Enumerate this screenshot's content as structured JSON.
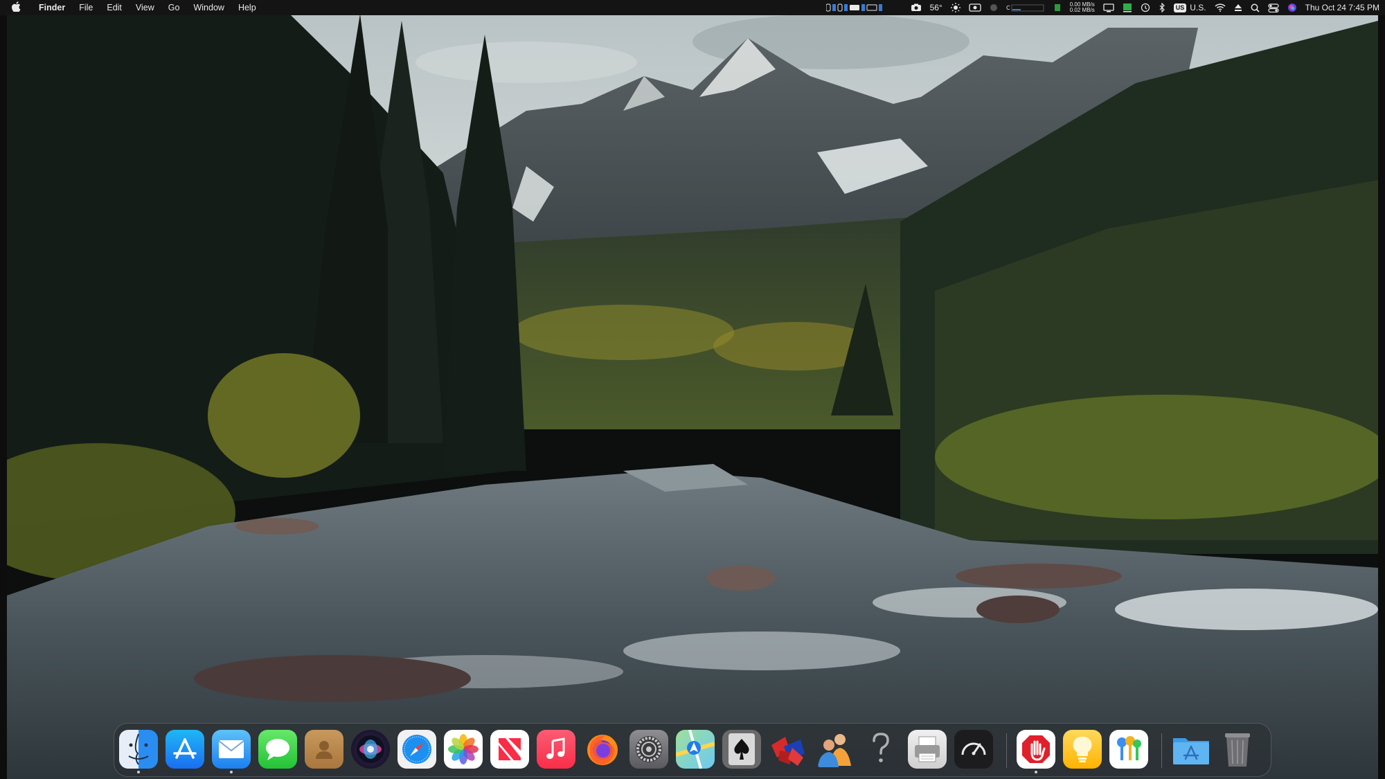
{
  "menubar": {
    "apple_icon": "apple-logo-icon",
    "app_name": "Finder",
    "menus": [
      "File",
      "Edit",
      "View",
      "Go",
      "Window",
      "Help"
    ],
    "status": {
      "temperature": "56°",
      "weather_icon": "sun-icon",
      "net_up": "0.00 MB/s",
      "net_down": "0.02 MB/s",
      "input_source_badge": "US",
      "input_source_label": "U.S.",
      "datetime": "Thu Oct 24  7:45 PM"
    }
  },
  "dock": {
    "apps": [
      {
        "name": "Finder",
        "icon": "finder-icon",
        "running": true
      },
      {
        "name": "App Store",
        "icon": "app-store-icon",
        "running": false
      },
      {
        "name": "Mail",
        "icon": "mail-icon",
        "running": true
      },
      {
        "name": "Messages",
        "icon": "messages-icon",
        "running": false
      },
      {
        "name": "Contacts",
        "icon": "contacts-icon",
        "running": false
      },
      {
        "name": "Siri",
        "icon": "siri-icon",
        "running": false
      },
      {
        "name": "Safari",
        "icon": "safari-icon",
        "running": false
      },
      {
        "name": "Photos",
        "icon": "photos-icon",
        "running": false
      },
      {
        "name": "News",
        "icon": "news-icon",
        "running": false
      },
      {
        "name": "Music",
        "icon": "music-icon",
        "running": false
      },
      {
        "name": "Firefox",
        "icon": "firefox-icon",
        "running": false
      },
      {
        "name": "System Settings",
        "icon": "settings-gear-icon",
        "running": false
      },
      {
        "name": "Maps",
        "icon": "maps-icon",
        "running": false
      },
      {
        "name": "Solitaire",
        "icon": "spade-card-icon",
        "running": false
      },
      {
        "name": "Chess",
        "icon": "chess-pieces-icon",
        "running": false
      },
      {
        "name": "Migration Assistant",
        "icon": "people-icon",
        "running": false
      },
      {
        "name": "Help",
        "icon": "question-mark-icon",
        "running": false
      },
      {
        "name": "Printer",
        "icon": "printer-icon",
        "running": false
      },
      {
        "name": "Speedometer",
        "icon": "speedometer-icon",
        "running": false
      }
    ],
    "extra_apps": [
      {
        "name": "Stop Hand",
        "icon": "stop-hand-icon",
        "running": true
      },
      {
        "name": "Tips",
        "icon": "lightbulb-icon",
        "running": false
      },
      {
        "name": "Keychain",
        "icon": "keys-icon",
        "running": false
      }
    ],
    "folders": [
      {
        "name": "Applications",
        "icon": "applications-folder-icon"
      },
      {
        "name": "Trash",
        "icon": "trash-icon"
      }
    ]
  },
  "colors": {
    "menubar_bg": "#141414",
    "menubar_text": "#e9e9e9",
    "dock_bg": "rgba(40,44,48,0.55)"
  }
}
